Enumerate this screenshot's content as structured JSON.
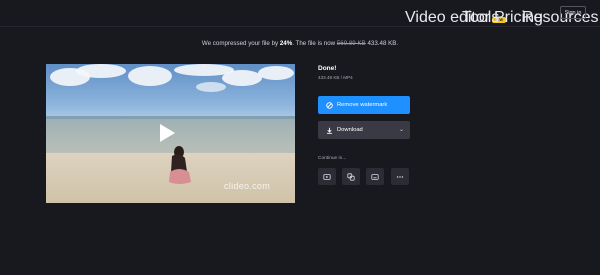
{
  "nav": {
    "video_editor": "Video editor",
    "new_badge": "NEW",
    "tools": "Tools",
    "pricing": "Pricing",
    "resources": "Resources",
    "sign_in": "Sign in"
  },
  "message": {
    "prefix": "We compressed your file by ",
    "percent": "24%",
    "middle": ". The file is now ",
    "old_size": "569.89 KB",
    "new_size": "433.48 KB."
  },
  "video": {
    "watermark": "clideo.com"
  },
  "file": {
    "title": "Done!",
    "meta": "433.48 KB  /  MP4"
  },
  "actions": {
    "remove_watermark": "Remove watermark",
    "download": "Download"
  },
  "continue": {
    "label": "Continue in..."
  },
  "colors": {
    "background": "#18181f",
    "primary": "#1e90ff",
    "secondary": "#3a3a44",
    "badge": "#f3c623"
  },
  "icons": {
    "remove_watermark": "no-watermark-icon",
    "download": "download-icon",
    "tools": [
      "video-editor-icon",
      "merge-icon",
      "subtitles-icon",
      "more-icon"
    ]
  }
}
